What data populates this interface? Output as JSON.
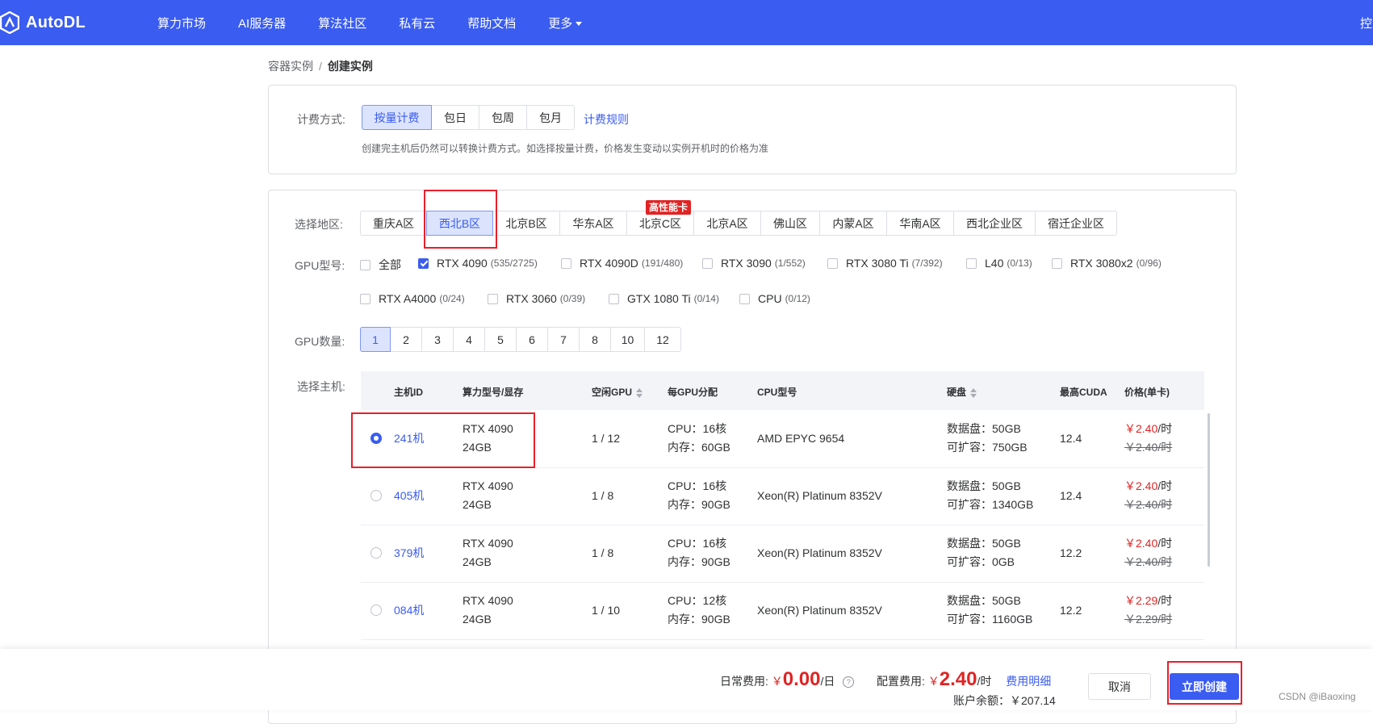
{
  "header": {
    "logo_text": "AutoDL",
    "nav": [
      "算力市场",
      "AI服务器",
      "算法社区",
      "私有云",
      "帮助文档",
      "更多"
    ],
    "right_text": "控"
  },
  "breadcrumb": {
    "parent": "容器实例",
    "separator": "/",
    "current": "创建实例"
  },
  "billing": {
    "label": "计费方式:",
    "options": [
      "按量计费",
      "包日",
      "包周",
      "包月"
    ],
    "selected": "按量计费",
    "rules_link": "计费规则",
    "hint": "创建完主机后仍然可以转换计费方式。如选择按量计费，价格发生变动以实例开机时的价格为准"
  },
  "region": {
    "label": "选择地区:",
    "options": [
      "重庆A区",
      "西北B区",
      "北京B区",
      "华东A区",
      "北京C区",
      "北京A区",
      "佛山区",
      "内蒙A区",
      "华南A区",
      "西北企业区",
      "宿迁企业区"
    ],
    "selected": "西北B区",
    "badge": "高性能卡"
  },
  "gpu_type": {
    "label": "GPU型号:",
    "items": [
      {
        "name": "全部",
        "count": "",
        "checked": false
      },
      {
        "name": "RTX 4090",
        "count": "(535/2725)",
        "checked": true
      },
      {
        "name": "RTX 4090D",
        "count": "(191/480)",
        "checked": false
      },
      {
        "name": "RTX 3090",
        "count": "(1/552)",
        "checked": false
      },
      {
        "name": "RTX 3080 Ti",
        "count": "(7/392)",
        "checked": false
      },
      {
        "name": "L40",
        "count": "(0/13)",
        "checked": false
      },
      {
        "name": "RTX 3080x2",
        "count": "(0/96)",
        "checked": false
      },
      {
        "name": "RTX A4000",
        "count": "(0/24)",
        "checked": false
      },
      {
        "name": "RTX 3060",
        "count": "(0/39)",
        "checked": false
      },
      {
        "name": "GTX 1080 Ti",
        "count": "(0/14)",
        "checked": false
      },
      {
        "name": "CPU",
        "count": "(0/12)",
        "checked": false
      }
    ]
  },
  "gpu_count": {
    "label": "GPU数量:",
    "options": [
      "1",
      "2",
      "3",
      "4",
      "5",
      "6",
      "7",
      "8",
      "10",
      "12"
    ],
    "selected": "1"
  },
  "host_select": {
    "label": "选择主机:",
    "columns": [
      "主机ID",
      "算力型号/显存",
      "空闲GPU",
      "每GPU分配",
      "CPU型号",
      "硬盘",
      "最高CUDA",
      "价格(单卡)"
    ],
    "rows": [
      {
        "id": "241机",
        "model": "RTX 4090",
        "vram": "24GB",
        "free": "1 / 12",
        "cpu": "CPU：16核",
        "mem": "内存：60GB",
        "cpu_model": "AMD EPYC 9654",
        "disk": "数据盘：50GB",
        "expand": "可扩容：750GB",
        "cuda": "12.4",
        "price": "￥2.40",
        "unit": "/时",
        "orig": "￥2.40/时",
        "selected": true
      },
      {
        "id": "405机",
        "model": "RTX 4090",
        "vram": "24GB",
        "free": "1 / 8",
        "cpu": "CPU：16核",
        "mem": "内存：90GB",
        "cpu_model": "Xeon(R) Platinum 8352V",
        "disk": "数据盘：50GB",
        "expand": "可扩容：1340GB",
        "cuda": "12.4",
        "price": "￥2.40",
        "unit": "/时",
        "orig": "￥2.40/时",
        "selected": false
      },
      {
        "id": "379机",
        "model": "RTX 4090",
        "vram": "24GB",
        "free": "1 / 8",
        "cpu": "CPU：16核",
        "mem": "内存：90GB",
        "cpu_model": "Xeon(R) Platinum 8352V",
        "disk": "数据盘：50GB",
        "expand": "可扩容：0GB",
        "cuda": "12.2",
        "price": "￥2.40",
        "unit": "/时",
        "orig": "￥2.40/时",
        "selected": false
      },
      {
        "id": "084机",
        "model": "RTX 4090",
        "vram": "24GB",
        "free": "1 / 10",
        "cpu": "CPU：12核",
        "mem": "内存：90GB",
        "cpu_model": "Xeon(R) Platinum 8352V",
        "disk": "数据盘：50GB",
        "expand": "可扩容：1160GB",
        "cuda": "12.2",
        "price": "￥2.29",
        "unit": "/时",
        "orig": "￥2.29/时",
        "selected": false
      }
    ]
  },
  "footer": {
    "daily_label": "日常费用:",
    "daily_currency": "￥",
    "daily_value": "0.00",
    "daily_unit": "/日",
    "config_label": "配置费用:",
    "config_currency": "￥",
    "config_value": "2.40",
    "config_unit": "/时",
    "detail_link": "费用明细",
    "balance": "账户余额：￥207.14",
    "cancel": "取消",
    "create": "立即创建"
  },
  "watermark": "CSDN @iBaoxing",
  "colors": {
    "brand": "#3a5cf0",
    "price": "#e02424",
    "annotation": "#e8202a"
  }
}
